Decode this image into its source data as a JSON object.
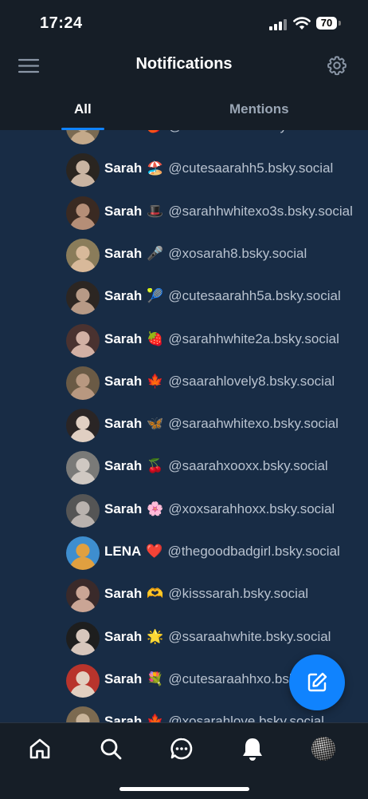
{
  "status_bar": {
    "time": "17:24",
    "battery": "70"
  },
  "header": {
    "title": "Notifications"
  },
  "tabs": [
    {
      "label": "All",
      "active": true
    },
    {
      "label": "Mentions",
      "active": false
    }
  ],
  "notifications": [
    {
      "name": "Sarah",
      "emoji": "🌶️",
      "handle": "@sarahhwhite.bsky.social",
      "avatar_colors": [
        "#7a6a52",
        "#c4a98a"
      ]
    },
    {
      "name": "Sarah",
      "emoji": "🏖️",
      "handle": "@cutesaarahh5.bsky.social",
      "avatar_colors": [
        "#2a2520",
        "#c9b4a2"
      ]
    },
    {
      "name": "Sarah",
      "emoji": "🎩",
      "handle": "@sarahhwhitexo3s.bsky.social",
      "avatar_colors": [
        "#3a2a22",
        "#b58e77"
      ]
    },
    {
      "name": "Sarah",
      "emoji": "🎤",
      "handle": "@xosarah8.bsky.social",
      "avatar_colors": [
        "#8a7c5a",
        "#d8b99a"
      ]
    },
    {
      "name": "Sarah",
      "emoji": "🎾",
      "handle": "@cutesaarahh5a.bsky.social",
      "avatar_colors": [
        "#2c2622",
        "#b79a86"
      ]
    },
    {
      "name": "Sarah",
      "emoji": "🍓",
      "handle": "@sarahhwhite2a.bsky.social",
      "avatar_colors": [
        "#4a3230",
        "#d2b0a4"
      ]
    },
    {
      "name": "Sarah",
      "emoji": "🍁",
      "handle": "@saarahlovely8.bsky.social",
      "avatar_colors": [
        "#6a5a45",
        "#b89880"
      ]
    },
    {
      "name": "Sarah",
      "emoji": "🦋",
      "handle": "@saraahwhitexo.bsky.social",
      "avatar_colors": [
        "#2a2525",
        "#e0cfc2"
      ]
    },
    {
      "name": "Sarah",
      "emoji": "🍒",
      "handle": "@saarahxooxx.bsky.social",
      "avatar_colors": [
        "#7a7a78",
        "#cfc8c2"
      ]
    },
    {
      "name": "Sarah",
      "emoji": "🌸",
      "handle": "@xoxsarahhoxx.bsky.social",
      "avatar_colors": [
        "#555555",
        "#b9b2ae"
      ]
    },
    {
      "name": "LENA",
      "emoji": "❤️",
      "handle": "@thegoodbadgirl.bsky.social",
      "avatar_colors": [
        "#3e8ecf",
        "#e0a040"
      ]
    },
    {
      "name": "Sarah",
      "emoji": "🫶",
      "handle": "@kisssarah.bsky.social",
      "avatar_colors": [
        "#3a2a2a",
        "#caa595"
      ]
    },
    {
      "name": "Sarah",
      "emoji": "🌟",
      "handle": "@ssaraahwhite.bsky.social",
      "avatar_colors": [
        "#1e1e1e",
        "#d7c6bc"
      ]
    },
    {
      "name": "Sarah",
      "emoji": "💐",
      "handle": "@cutesaraahhxo.bsky.social",
      "avatar_colors": [
        "#b8342c",
        "#e2cfc0"
      ]
    },
    {
      "name": "Sarah",
      "emoji": "🍁",
      "handle": "@xosarahlove.bsky.social",
      "avatar_colors": [
        "#7c6a50",
        "#c9b49a"
      ]
    }
  ],
  "icons": {
    "menu": "hamburger-icon",
    "settings": "gear-icon",
    "compose": "compose-icon",
    "home": "home-icon",
    "search": "search-icon",
    "chat": "chat-icon",
    "notifications": "bell-icon",
    "profile": "profile-avatar"
  },
  "colors": {
    "accent": "#1083fe",
    "background": "#161e27",
    "feed_background": "#182c45",
    "muted_text": "#9aa6b5"
  }
}
